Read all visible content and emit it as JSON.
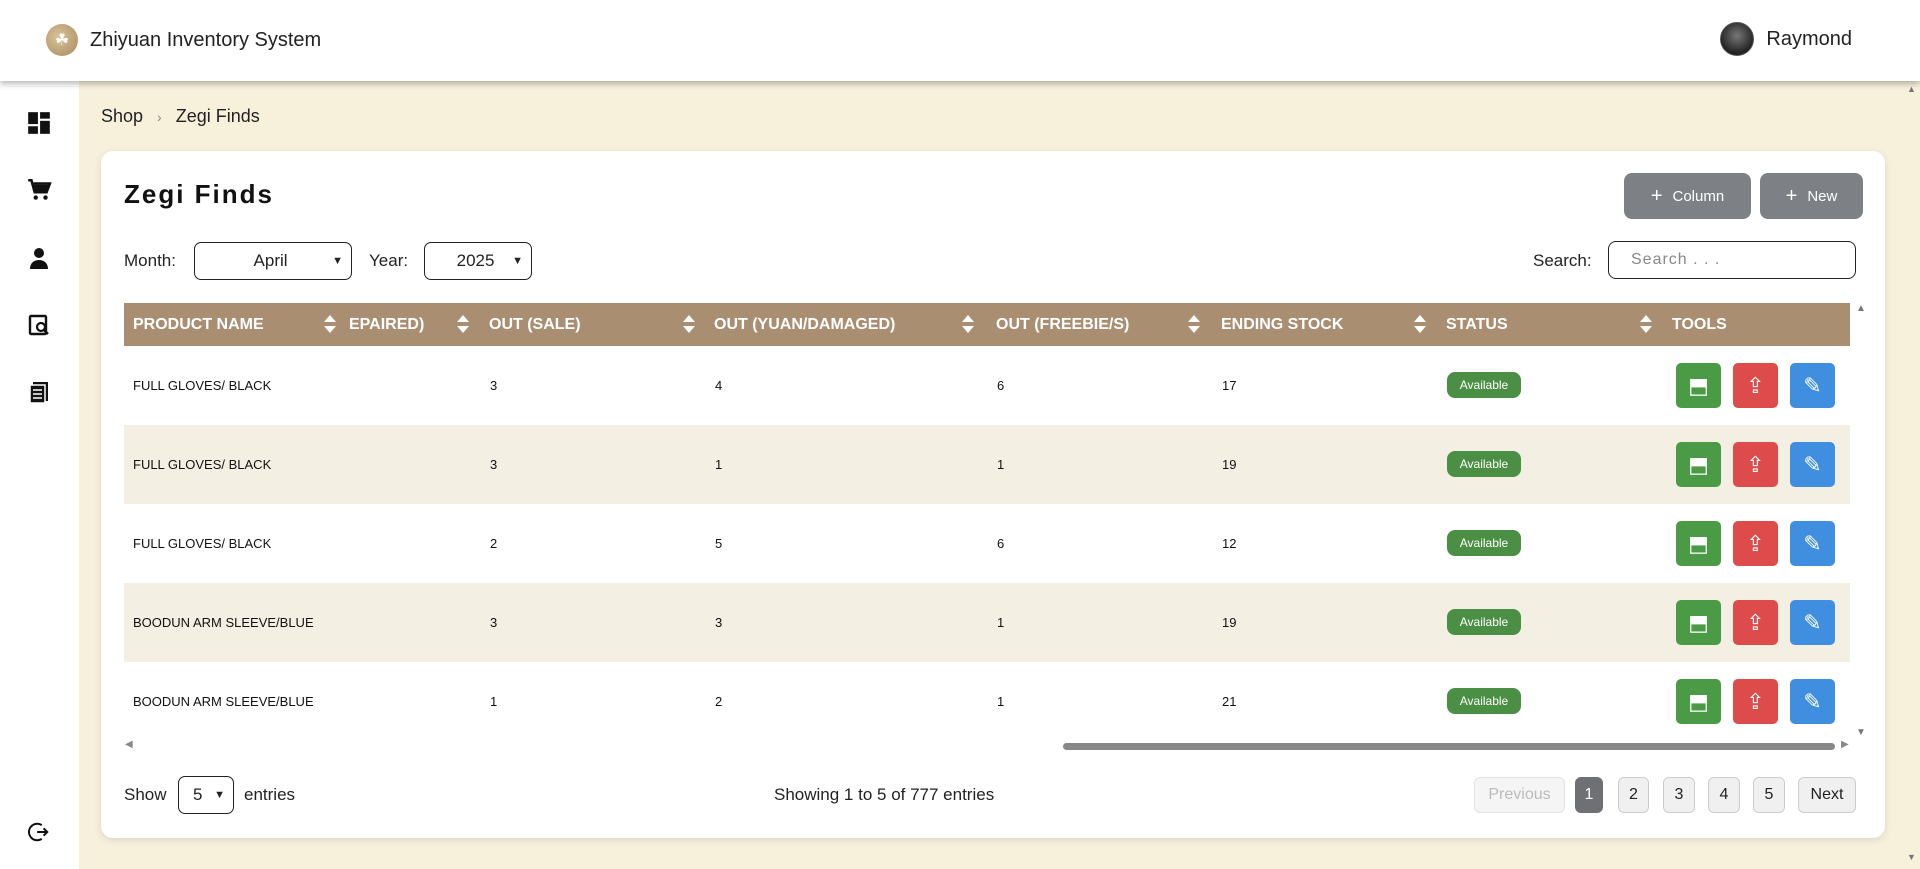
{
  "app": {
    "title": "Zhiyuan Inventory System",
    "user_name": "Raymond"
  },
  "sidebar": {
    "items": [
      {
        "name": "dashboard",
        "icon": "dashboard-icon"
      },
      {
        "name": "shop",
        "icon": "cart-icon"
      },
      {
        "name": "users",
        "icon": "user-icon"
      },
      {
        "name": "reports",
        "icon": "search-document-icon"
      },
      {
        "name": "documents",
        "icon": "document-icon"
      },
      {
        "name": "logout",
        "icon": "logout-icon"
      }
    ]
  },
  "breadcrumb": {
    "items": [
      "Shop",
      "Zegi Finds"
    ],
    "separator": "›"
  },
  "card": {
    "title": "Zegi Finds",
    "column_button": "Column",
    "new_button": "New"
  },
  "filters": {
    "month_label": "Month:",
    "month_value": "April",
    "year_label": "Year:",
    "year_value": "2025",
    "search_label": "Search:",
    "search_placeholder": "Search . . ."
  },
  "table": {
    "headers": {
      "product_name": "PRODUCT NAME",
      "repaired": "EPAIRED)",
      "out_sale": "OUT (SALE)",
      "out_yuan": "OUT (YUAN/DAMAGED)",
      "out_freebie": "OUT (FREEBIE/S)",
      "ending_stock": "ENDING STOCK",
      "status": "STATUS",
      "tools": "TOOLS"
    },
    "rows": [
      {
        "product": "FULL GLOVES/ BLACK",
        "out_sale": "3",
        "out_yuan": "4",
        "out_freebie": "6",
        "ending_stock": "17",
        "status": "Available"
      },
      {
        "product": "FULL GLOVES/ BLACK",
        "out_sale": "3",
        "out_yuan": "1",
        "out_freebie": "1",
        "ending_stock": "19",
        "status": "Available"
      },
      {
        "product": "FULL GLOVES/ BLACK",
        "out_sale": "2",
        "out_yuan": "5",
        "out_freebie": "6",
        "ending_stock": "12",
        "status": "Available"
      },
      {
        "product": "BOODUN ARM SLEEVE/BLUE",
        "out_sale": "3",
        "out_yuan": "3",
        "out_freebie": "1",
        "ending_stock": "19",
        "status": "Available"
      },
      {
        "product": "BOODUN ARM SLEEVE/BLUE",
        "out_sale": "1",
        "out_yuan": "2",
        "out_freebie": "1",
        "ending_stock": "21",
        "status": "Available"
      }
    ]
  },
  "footer": {
    "show_label": "Show",
    "entries_value": "5",
    "entries_label": "entries",
    "info": "Showing 1 to 5 of 777 entries",
    "previous": "Previous",
    "pages": [
      "1",
      "2",
      "3",
      "4",
      "5"
    ],
    "next": "Next",
    "active_page": "1"
  },
  "colors": {
    "header_bg": "#a98e72",
    "page_bg": "#f7f1dc",
    "status_green": "#4a8f43",
    "tool_green": "#4b9a45",
    "tool_red": "#dd4b4b",
    "tool_blue": "#3f8ee0"
  }
}
